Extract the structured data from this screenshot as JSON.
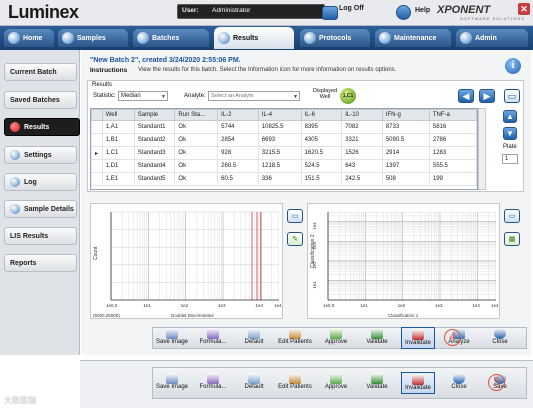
{
  "app": {
    "logo": "Luminex",
    "brand": "XPONENT",
    "brand_sub": "SOFTWARE SOLUTIONS"
  },
  "user": {
    "label": "User:",
    "value": "Administrator"
  },
  "top": {
    "logoff": "Log Off",
    "help": "Help"
  },
  "tabs": [
    "Home",
    "Samples",
    "Batches",
    "Results",
    "Protocols",
    "Maintenance",
    "Admin"
  ],
  "active_tab": "Results",
  "sidebar": [
    "Current Batch",
    "Saved Batches",
    "Results",
    "Settings",
    "Log",
    "Sample Details",
    "LIS Results",
    "Reports"
  ],
  "header": {
    "batch_title": "\"New Batch 2\", created 3/24/2020 2:55:06 PM.",
    "instructions_label": "Instructions",
    "instructions_text": "View the results for this batch. Select the Information icon for more information on results options."
  },
  "results": {
    "label": "Results",
    "statistic_label": "Statistic:",
    "statistic_value": "Median",
    "analyte_label": "Analyte:",
    "analyte_placeholder": "Select an Analyte",
    "displayed_well_label": "Displayed Well",
    "lot_label": "1,C1",
    "columns": [
      "Well",
      "Sample",
      "Run Sta...",
      "IL-2",
      "IL-4",
      "IL-6",
      "IL-10",
      "IFN-g",
      "TNF-a"
    ],
    "rows": [
      [
        "1,A1",
        "Standard1",
        "Ok",
        "5744",
        "10825.5",
        "8395",
        "7082",
        "8733",
        "5816"
      ],
      [
        "1,B1",
        "Standard2",
        "Ok",
        "2854",
        "6693",
        "4305",
        "3321",
        "5090.5",
        "2786"
      ],
      [
        "1,C1",
        "Standard3",
        "Ok",
        "928",
        "3215.5",
        "1620.5",
        "1526",
        "2914",
        "1283"
      ],
      [
        "1,D1",
        "Standard4",
        "Ok",
        "260.5",
        "1218.5",
        "524.5",
        "643",
        "1397",
        "555.5"
      ],
      [
        "1,E1",
        "Standard5",
        "Ok",
        "60.5",
        "336",
        "151.5",
        "242.5",
        "508",
        "199"
      ]
    ],
    "plate_label": "Plate",
    "plate_value": "1"
  },
  "plot1": {
    "ylabel": "Count",
    "xlabel": "Doublet Discriminator",
    "range": "(5000,25000)",
    "ticks": [
      "1e0.0",
      "1e1",
      "1e2",
      "1e3",
      "1e4",
      "1e4.5"
    ]
  },
  "plot2": {
    "ylabel": "Classification 2",
    "xlabel": "Classification 1",
    "xticks": [
      "1e0.0",
      "1e1",
      "1e2",
      "1e3",
      "1e4",
      "1e4.5"
    ],
    "yticks": [
      "1e4",
      "1e3",
      "1e2",
      "1e1"
    ]
  },
  "actionbar1": [
    "Save Image",
    "Formula...",
    "Default",
    "Edit Patients",
    "Approve",
    "Validate",
    "Invalidate",
    "Analyze",
    "Close"
  ],
  "actionbar2": [
    "Save Image",
    "Formula...",
    "Default",
    "Edit Patients",
    "Approve",
    "Validate",
    "Invalidate",
    "Close",
    "Save"
  ],
  "markers": {
    "m4": "4",
    "m5": "5"
  },
  "watermark": "大数医咖",
  "colors": {
    "accent": "#1a56a6",
    "active_dot": "#d01818",
    "marker": "#e2533a"
  }
}
